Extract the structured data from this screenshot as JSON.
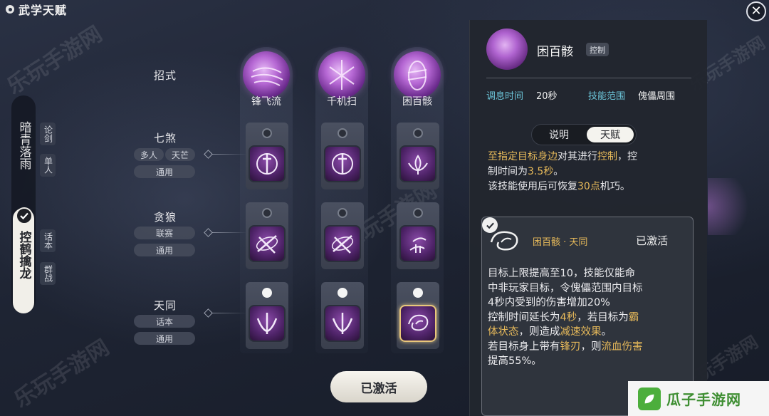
{
  "window": {
    "title": "武学天赋",
    "close_label": "✕"
  },
  "characters": {
    "inactive": {
      "name": "暗青落雨",
      "tags": [
        "论剑",
        "单人"
      ]
    },
    "active": {
      "name": "控鹤擒龙",
      "tags": [
        "话本",
        "群战"
      ]
    }
  },
  "rows": [
    {
      "label": "招式"
    },
    {
      "label": "七煞",
      "pills": [
        "多人",
        "天芒",
        "通用"
      ]
    },
    {
      "label": "贪狼",
      "pills": [
        "联赛",
        "通用"
      ]
    },
    {
      "label": "天同",
      "pills": [
        "话本",
        "通用"
      ]
    }
  ],
  "skills": [
    {
      "name": "锋飞流"
    },
    {
      "name": "千机扫"
    },
    {
      "name": "困百骸"
    }
  ],
  "activate_button": "已激活",
  "detail": {
    "skill_name": "困百骸",
    "type_badge": "控制",
    "cooldown_label": "调息时间",
    "cooldown_value": "20秒",
    "range_label": "技能范围",
    "range_value": "傀儡周围",
    "tab_description": "说明",
    "tab_talent": "天赋",
    "desc_line1_a": "至指定目标身边",
    "desc_line1_b": "对其进行",
    "desc_line1_c": "控制",
    "desc_line1_d": "，控",
    "desc_line2_a": "制时间为",
    "desc_line2_b": "3.5秒",
    "desc_line2_c": "。",
    "desc_line3_a": "该技能使用后可恢复",
    "desc_line3_b": "30点",
    "desc_line3_c": "机巧。",
    "talent": {
      "name": "困百骸 · 天同",
      "status": "已激活",
      "line1": "目标上限提高至10，技能仅能命",
      "line2": "中非玩家目标，令傀儡范围内目标",
      "line3": "4秒内受到的伤害增加20%",
      "line4_a": "控制时间延长为",
      "line4_b": "4秒",
      "line4_c": "，若目标为",
      "line4_d": "霸",
      "line5_a": "体状态",
      "line5_b": "，则造成",
      "line5_c": "减速效果",
      "line5_d": "。",
      "line6_a": "若目标身上带有",
      "line6_b": "锋刃",
      "line6_c": "，则",
      "line6_d": "流血伤害",
      "line7": "提高55%。"
    }
  },
  "watermark": "乐玩手游网",
  "brand": "瓜子手游网",
  "colors": {
    "accent_gold": "#e6b95a",
    "attr_cyan": "#6cc5d9",
    "brand_green": "#4cae3c"
  }
}
